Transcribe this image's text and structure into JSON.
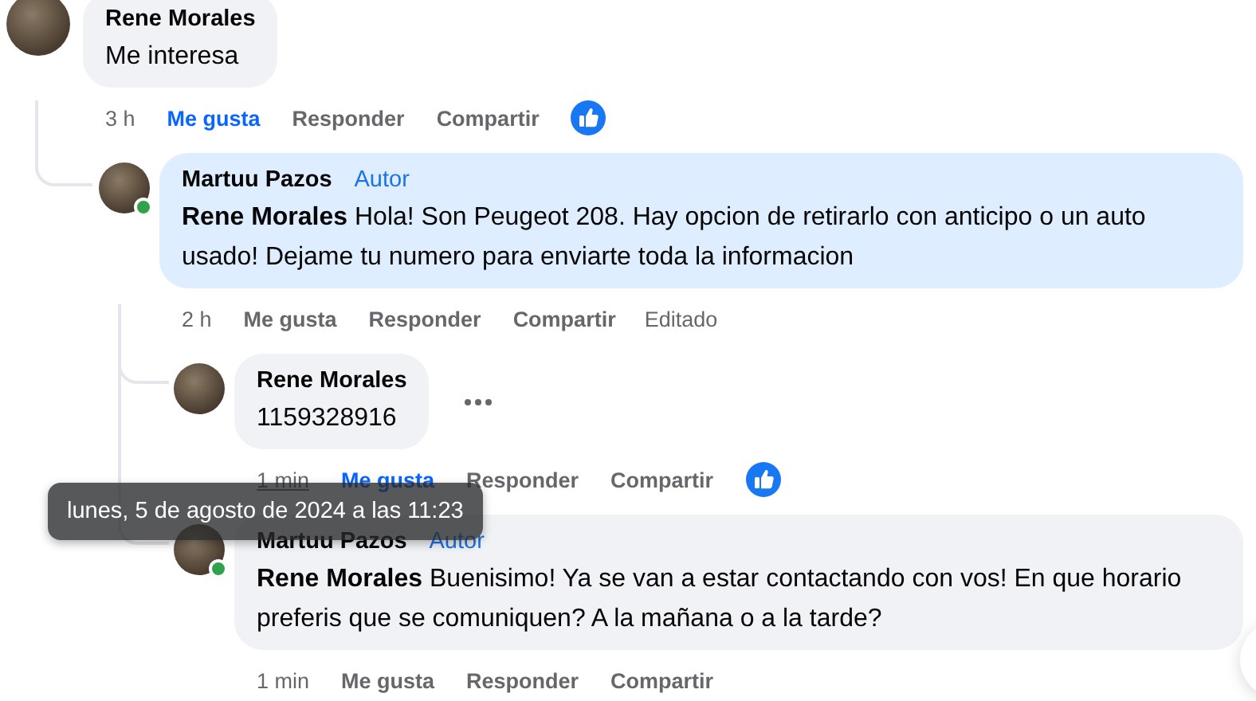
{
  "comments": [
    {
      "author": "Rene Morales",
      "text": "Me interesa",
      "time": "3 h",
      "time_hovered": false,
      "reaction": true,
      "actions": [
        {
          "label": "Me gusta",
          "selected": true
        },
        {
          "label": "Responder",
          "selected": false
        },
        {
          "label": "Compartir",
          "selected": false
        }
      ],
      "children": [
        {
          "author": "Martuu Pazos",
          "badge": "Autor",
          "text": "**Rene Morales** Hola! Son Peugeot 208. Hay opcion de retirarlo con anticipo o un auto usado! Dejame tu numero para enviarte toda la informacion",
          "time": "2 h",
          "time_hovered": false,
          "online": true,
          "highlighted": true,
          "edited": "Editado",
          "actions": [
            {
              "label": "Me gusta",
              "selected": false
            },
            {
              "label": "Responder",
              "selected": false
            },
            {
              "label": "Compartir",
              "selected": false
            }
          ],
          "children": [
            {
              "author": "Rene Morales",
              "text": "1159328916",
              "time": "1 min",
              "time_hovered": true,
              "more_menu": true,
              "reaction": true,
              "actions": [
                {
                  "label": "Me gusta",
                  "selected": true
                },
                {
                  "label": "Responder",
                  "selected": false
                },
                {
                  "label": "Compartir",
                  "selected": false
                }
              ]
            },
            {
              "author": "Martuu Pazos",
              "badge": "Autor",
              "text": "**Rene Morales** Buenisimo! Ya se van a estar contactando con vos! En que horario preferis que se comuniquen? A la mañana o a la tarde?",
              "time": "1 min",
              "time_hovered": false,
              "online": true,
              "actions": [
                {
                  "label": "Me gusta",
                  "selected": false
                },
                {
                  "label": "Responder",
                  "selected": false
                },
                {
                  "label": "Compartir",
                  "selected": false
                }
              ]
            }
          ]
        }
      ]
    }
  ],
  "tooltip": {
    "text": "lunes, 5 de agosto de 2024 a las 11:23"
  }
}
